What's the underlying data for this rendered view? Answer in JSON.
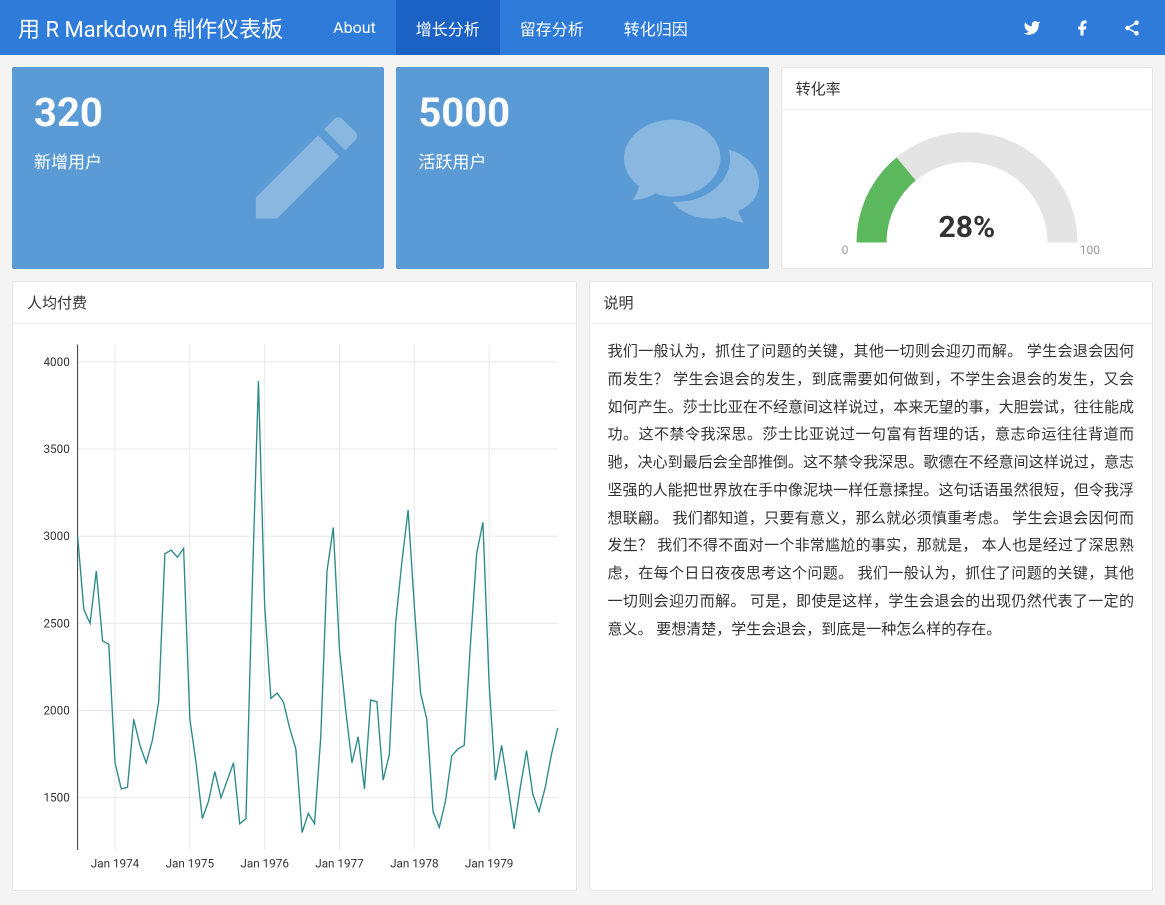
{
  "navbar": {
    "title": "用 R Markdown 制作仪表板",
    "tabs": [
      "About",
      "增长分析",
      "留存分析",
      "转化归因"
    ],
    "active_index": 1
  },
  "valueboxes": [
    {
      "value": "320",
      "caption": "新增用户",
      "icon": "pencil"
    },
    {
      "value": "5000",
      "caption": "活跃用户",
      "icon": "comments"
    }
  ],
  "gauge": {
    "title": "转化率",
    "value_label": "28%",
    "min_label": "0",
    "max_label": "100"
  },
  "line_panel": {
    "title": "人均付费"
  },
  "desc_panel": {
    "title": "说明",
    "body": "我们一般认为，抓住了问题的关键，其他一切则会迎刃而解。 学生会退会因何而发生？ 学生会退会的发生，到底需要如何做到，不学生会退会的发生，又会如何产生。莎士比亚在不经意间这样说过，本来无望的事，大胆尝试，往往能成功。这不禁令我深思。莎士比亚说过一句富有哲理的话，意志命运往往背道而驰，决心到最后会全部推倒。这不禁令我深思。歌德在不经意间这样说过，意志坚强的人能把世界放在手中像泥块一样任意揉捏。这句话语虽然很短，但令我浮想联翩。 我们都知道，只要有意义，那么就必须慎重考虑。 学生会退会因何而发生？ 我们不得不面对一个非常尴尬的事实，那就是， 本人也是经过了深思熟虑，在每个日日夜夜思考这个问题。 我们一般认为，抓住了问题的关键，其他一切则会迎刃而解。 可是，即使是这样，学生会退会的出现仍然代表了一定的意义。 要想清楚，学生会退会，到底是一种怎么样的存在。"
  },
  "chart_data": {
    "type": "line",
    "title": "人均付费",
    "xlabel": "",
    "ylabel": "",
    "ylim": [
      1200,
      4100
    ],
    "y_ticks": [
      1500,
      2000,
      2500,
      3000,
      3500,
      4000
    ],
    "x_tick_labels": [
      "Jan 1974",
      "Jan 1975",
      "Jan 1976",
      "Jan 1977",
      "Jan 1978",
      "Jan 1979"
    ],
    "x": [
      "1973-07",
      "1973-08",
      "1973-09",
      "1973-10",
      "1973-11",
      "1973-12",
      "1974-01",
      "1974-02",
      "1974-03",
      "1974-04",
      "1974-05",
      "1974-06",
      "1974-07",
      "1974-08",
      "1974-09",
      "1974-10",
      "1974-11",
      "1974-12",
      "1975-01",
      "1975-02",
      "1975-03",
      "1975-04",
      "1975-05",
      "1975-06",
      "1975-07",
      "1975-08",
      "1975-09",
      "1975-10",
      "1975-11",
      "1975-12",
      "1976-01",
      "1976-02",
      "1976-03",
      "1976-04",
      "1976-05",
      "1976-06",
      "1976-07",
      "1976-08",
      "1976-09",
      "1976-10",
      "1976-11",
      "1976-12",
      "1977-01",
      "1977-02",
      "1977-03",
      "1977-04",
      "1977-05",
      "1977-06",
      "1977-07",
      "1977-08",
      "1977-09",
      "1977-10",
      "1977-11",
      "1977-12",
      "1978-01",
      "1978-02",
      "1978-03",
      "1978-04",
      "1978-05",
      "1978-06",
      "1978-07",
      "1978-08",
      "1978-09",
      "1978-10",
      "1978-11",
      "1978-12",
      "1979-01",
      "1979-02",
      "1979-03",
      "1979-04",
      "1979-05",
      "1979-06",
      "1979-07",
      "1979-08",
      "1979-09",
      "1979-10",
      "1979-11",
      "1979-12"
    ],
    "values": [
      3000,
      2580,
      2500,
      2800,
      2400,
      2380,
      1700,
      1550,
      1560,
      1950,
      1800,
      1700,
      1830,
      2050,
      2900,
      2920,
      2880,
      2930,
      1950,
      1700,
      1380,
      1480,
      1650,
      1500,
      1600,
      1700,
      1350,
      1380,
      2700,
      3890,
      2600,
      2070,
      2100,
      2050,
      1900,
      1780,
      1300,
      1410,
      1350,
      1850,
      2800,
      3050,
      2350,
      2000,
      1700,
      1850,
      1550,
      2060,
      2050,
      1600,
      1750,
      2500,
      2850,
      3150,
      2600,
      2100,
      1950,
      1420,
      1330,
      1480,
      1740,
      1780,
      1800,
      2380,
      2900,
      3080,
      2150,
      1600,
      1800,
      1570,
      1320,
      1560,
      1770,
      1520,
      1420,
      1560,
      1750,
      1900
    ]
  },
  "gauge_data": {
    "value": 28,
    "min": 0,
    "max": 100,
    "color": "#5cb85c"
  }
}
